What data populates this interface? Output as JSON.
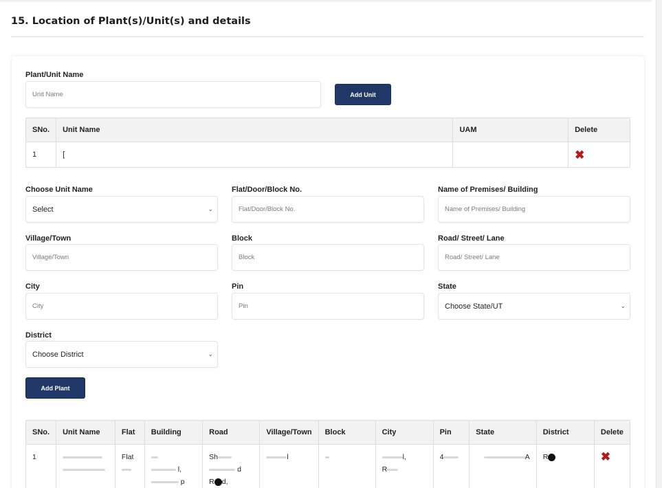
{
  "section": {
    "title": "15. Location of Plant(s)/Unit(s) and details"
  },
  "unit_form": {
    "name_label": "Plant/Unit Name",
    "name_placeholder": "Unit Name",
    "add_unit_label": "Add Unit"
  },
  "unit_table": {
    "headers": [
      "SNo.",
      "Unit Name",
      "UAM",
      "Delete"
    ],
    "rows": [
      {
        "sno": "1",
        "unit_name": "[",
        "uam": "",
        "delete_icon": "delete-x-icon"
      }
    ]
  },
  "plant_form": {
    "choose_unit_label": "Choose Unit Name",
    "choose_unit_value": "Select",
    "flat_label": "Flat/Door/Block No.",
    "flat_placeholder": "Flat/Door/Block No.",
    "premises_label": "Name of Premises/ Building",
    "premises_placeholder": "Name of Premises/ Building",
    "village_label": "Village/Town",
    "village_placeholder": "Village/Town",
    "block_label": "Block",
    "block_placeholder": "Block",
    "road_label": "Road/ Street/ Lane",
    "road_placeholder": "Road/ Street/ Lane",
    "city_label": "City",
    "city_placeholder": "City",
    "pin_label": "Pin",
    "pin_placeholder": "Pin",
    "state_label": "State",
    "state_value": "Choose State/UT",
    "district_label": "District",
    "district_value": "Choose District",
    "add_plant_label": "Add Plant"
  },
  "plant_table": {
    "headers": [
      "SNo.",
      "Unit Name",
      "Flat",
      "Building",
      "Road",
      "Village/Town",
      "Block",
      "City",
      "Pin",
      "State",
      "District",
      "Delete"
    ],
    "row": {
      "sno": "1",
      "flat_1": "Flat",
      "road_1": "Sh",
      "road_2": "d",
      "road_3": "R",
      "road_3b": "d,",
      "building_2": "l,",
      "building_3": "p",
      "city_1": "l,",
      "city_2": "R",
      "village": "l",
      "pin": "4",
      "state": "A",
      "district": "R",
      "delete_icon": "delete-x-icon"
    }
  },
  "colors": {
    "primary_button": "#1f3867",
    "delete_icon": "#b01c1c",
    "table_header_bg": "#f2f2f2"
  }
}
